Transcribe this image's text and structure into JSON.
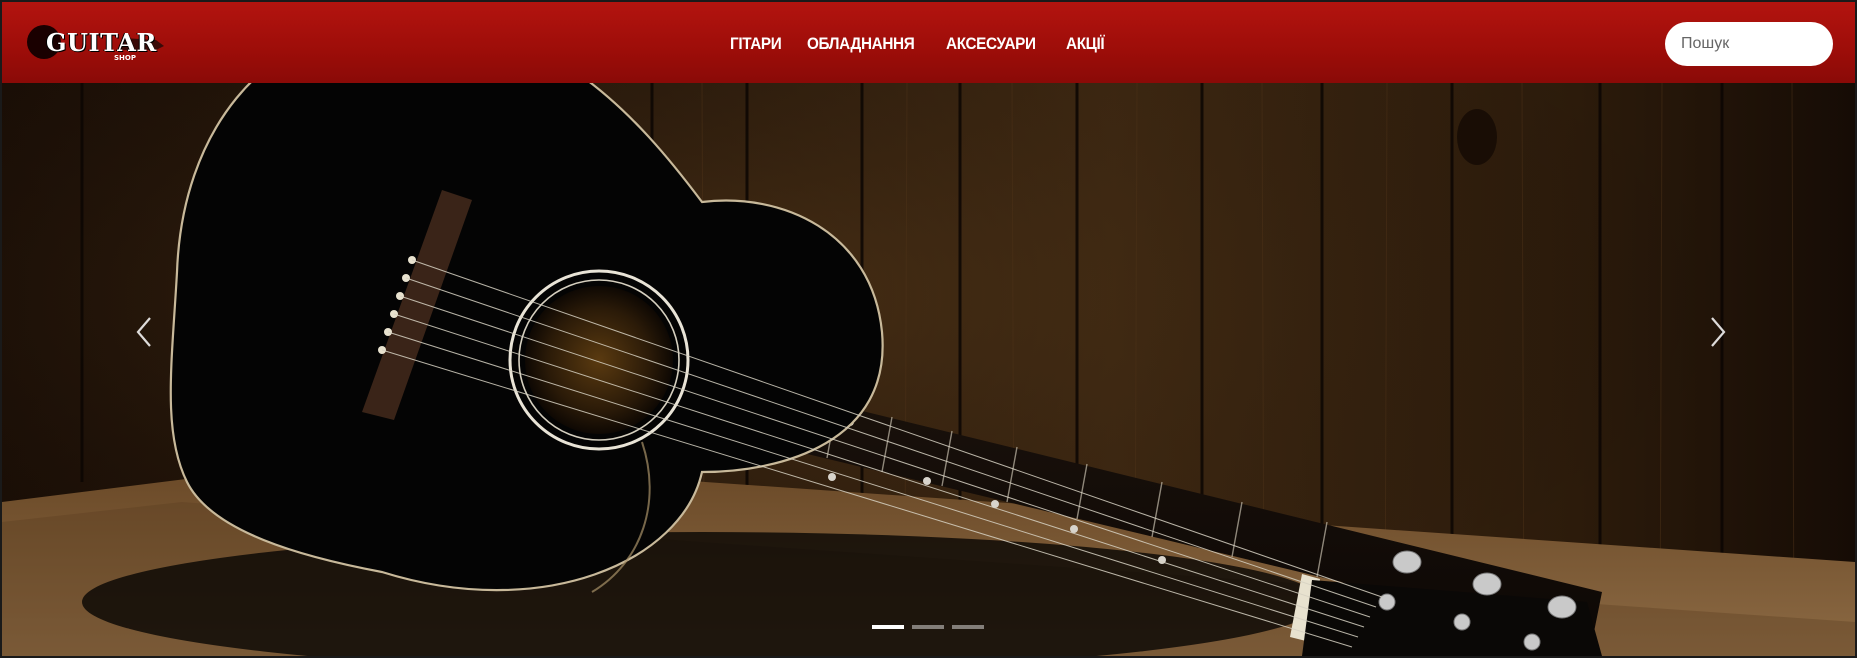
{
  "header": {
    "logo": {
      "text": "GUITAR",
      "sub": "SHOP"
    },
    "nav": [
      {
        "label": "ГІТАРИ"
      },
      {
        "label": "ОБЛАДНАННЯ"
      },
      {
        "label": "АКСЕСУАРИ"
      },
      {
        "label": "АКЦІЇ"
      }
    ],
    "search": {
      "placeholder": "Пошук",
      "value": ""
    }
  },
  "carousel": {
    "slide_count": 3,
    "active_slide": 1,
    "prev_icon": "chevron-left-icon",
    "next_icon": "chevron-right-icon"
  },
  "colors": {
    "header_red": "#a9110c",
    "wood": "#3a2410",
    "guitar_body": "#050505"
  }
}
